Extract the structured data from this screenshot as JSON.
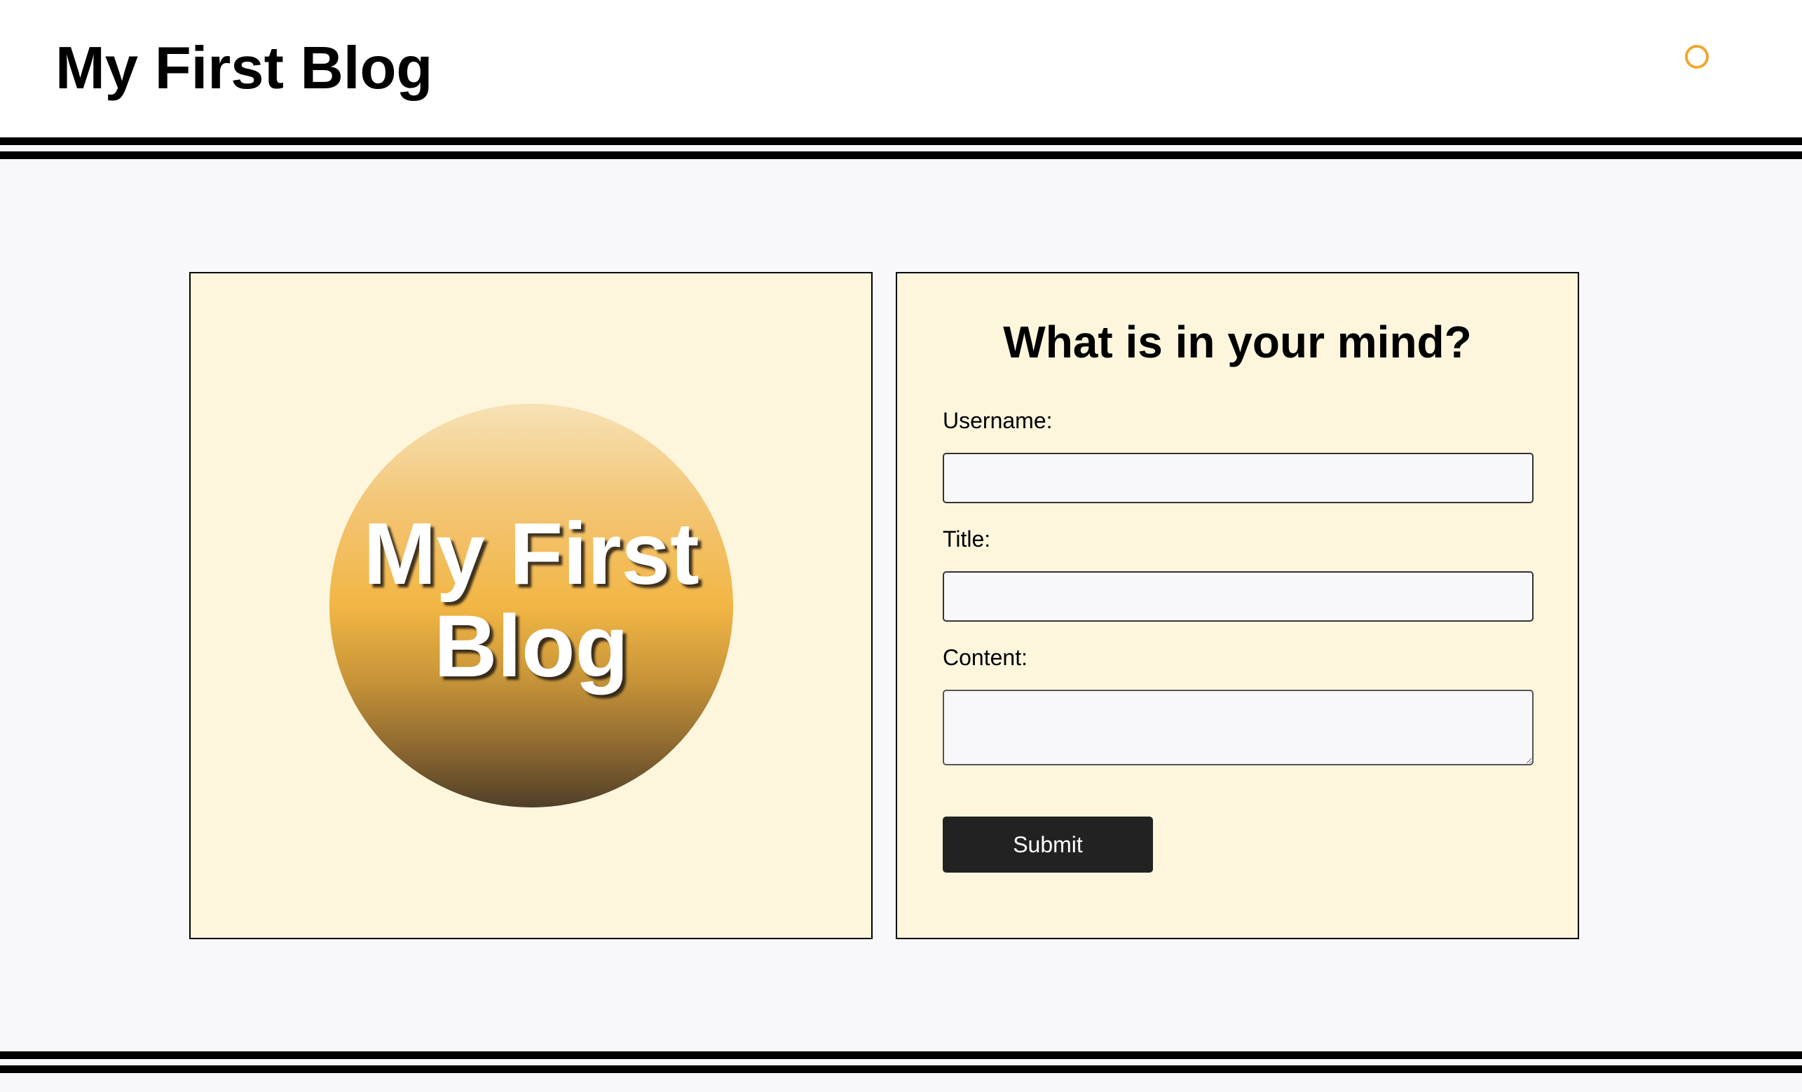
{
  "header": {
    "title": "My First Blog"
  },
  "theme_toggle": {
    "icon": "circle-icon",
    "color": "#f0a830"
  },
  "logo": {
    "line1": "My First",
    "line2": "Blog"
  },
  "form": {
    "heading": "What is in your mind?",
    "username_label": "Username:",
    "username_value": "",
    "title_label": "Title:",
    "title_value": "",
    "content_label": "Content:",
    "content_value": "",
    "submit_label": "Submit"
  },
  "colors": {
    "card_background": "#fdf6dd",
    "page_background": "#f8f8fa",
    "button_background": "#222222",
    "accent": "#f0a830"
  }
}
